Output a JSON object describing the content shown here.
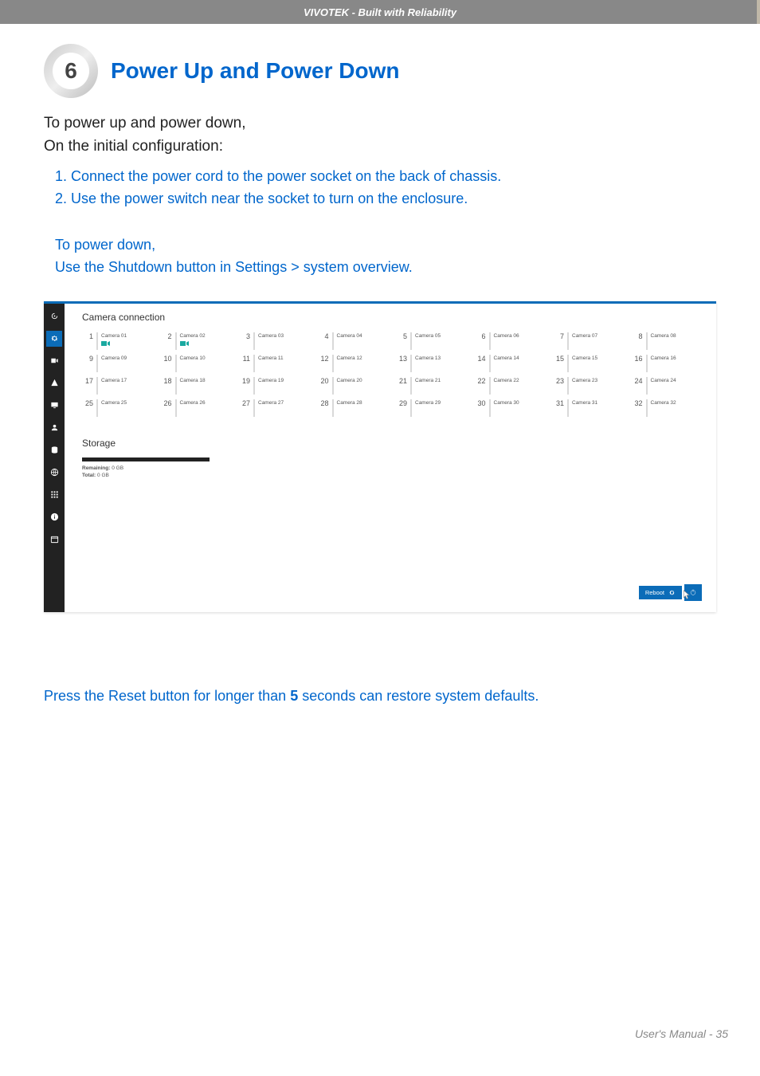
{
  "header": {
    "text": "VIVOTEK - Built with Reliability"
  },
  "section": {
    "num": "6",
    "title": "Power Up and Power Down"
  },
  "intro": {
    "line1": "To power up and power down,",
    "line2": "On the initial configuration:"
  },
  "steps": {
    "s1": "1. Connect the power cord to the power socket on the back of chassis.",
    "s2": "2. Use the power switch near the socket to turn on the enclosure."
  },
  "powerdown": {
    "title": "To power down,",
    "line": "Use the Shutdown button in Settings > system overview."
  },
  "app": {
    "camera_title": "Camera connection",
    "cameras": [
      {
        "n": "1",
        "label": "Camera 01",
        "live": true
      },
      {
        "n": "2",
        "label": "Camera 02",
        "live": true
      },
      {
        "n": "3",
        "label": "Camera 03",
        "live": false
      },
      {
        "n": "4",
        "label": "Camera 04",
        "live": false
      },
      {
        "n": "5",
        "label": "Camera 05",
        "live": false
      },
      {
        "n": "6",
        "label": "Camera 06",
        "live": false
      },
      {
        "n": "7",
        "label": "Camera 07",
        "live": false
      },
      {
        "n": "8",
        "label": "Camera 08",
        "live": false
      },
      {
        "n": "9",
        "label": "Camera 09",
        "live": false
      },
      {
        "n": "10",
        "label": "Camera 10",
        "live": false
      },
      {
        "n": "11",
        "label": "Camera 11",
        "live": false
      },
      {
        "n": "12",
        "label": "Camera 12",
        "live": false
      },
      {
        "n": "13",
        "label": "Camera 13",
        "live": false
      },
      {
        "n": "14",
        "label": "Camera 14",
        "live": false
      },
      {
        "n": "15",
        "label": "Camera 15",
        "live": false
      },
      {
        "n": "16",
        "label": "Camera 16",
        "live": false
      },
      {
        "n": "17",
        "label": "Camera 17",
        "live": false
      },
      {
        "n": "18",
        "label": "Camera 18",
        "live": false
      },
      {
        "n": "19",
        "label": "Camera 19",
        "live": false
      },
      {
        "n": "20",
        "label": "Camera 20",
        "live": false
      },
      {
        "n": "21",
        "label": "Camera 21",
        "live": false
      },
      {
        "n": "22",
        "label": "Camera 22",
        "live": false
      },
      {
        "n": "23",
        "label": "Camera 23",
        "live": false
      },
      {
        "n": "24",
        "label": "Camera 24",
        "live": false
      },
      {
        "n": "25",
        "label": "Camera 25",
        "live": false
      },
      {
        "n": "26",
        "label": "Camera 26",
        "live": false
      },
      {
        "n": "27",
        "label": "Camera 27",
        "live": false
      },
      {
        "n": "28",
        "label": "Camera 28",
        "live": false
      },
      {
        "n": "29",
        "label": "Camera 29",
        "live": false
      },
      {
        "n": "30",
        "label": "Camera 30",
        "live": false
      },
      {
        "n": "31",
        "label": "Camera 31",
        "live": false
      },
      {
        "n": "32",
        "label": "Camera 32",
        "live": false
      }
    ],
    "storage": {
      "title": "Storage",
      "remaining_label": "Remaining:",
      "remaining_value": "0 GB",
      "total_label": "Total:",
      "total_value": "0 GB"
    },
    "reboot_label": "Reboot"
  },
  "reset_note": {
    "pre": "Press the Reset button for longer than ",
    "bold": "5",
    "post": " seconds can restore system defaults."
  },
  "footer": {
    "text": "User's Manual - 35"
  }
}
